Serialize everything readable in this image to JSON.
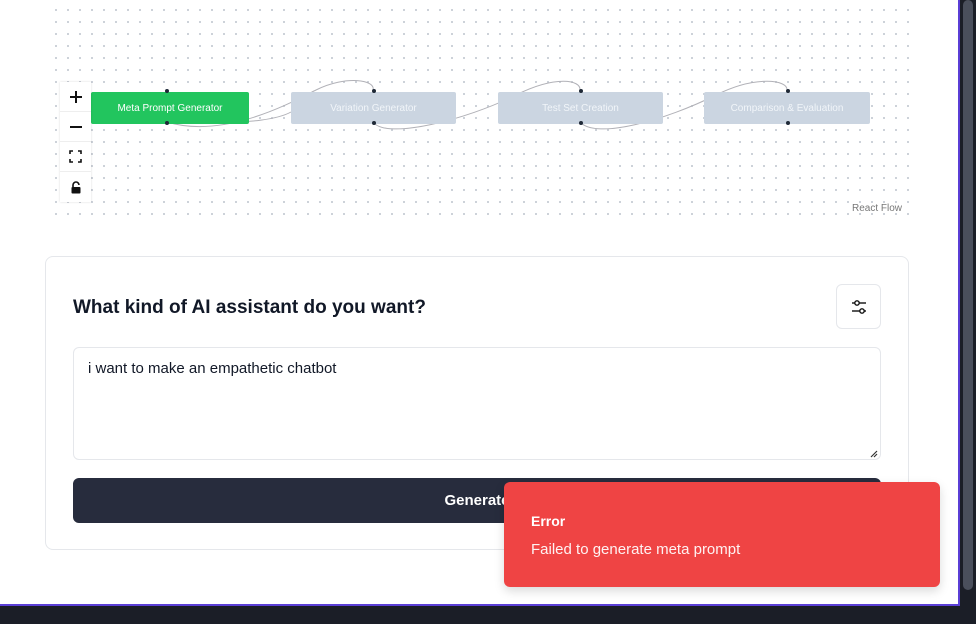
{
  "flow": {
    "nodes": [
      {
        "label": "Meta Prompt Generator",
        "state": "active"
      },
      {
        "label": "Variation Generator",
        "state": "inactive"
      },
      {
        "label": "Test Set Creation",
        "state": "inactive"
      },
      {
        "label": "Comparison & Evaluation",
        "state": "inactive"
      }
    ],
    "controls": {
      "zoom_in_icon": "plus-icon",
      "zoom_out_icon": "minus-icon",
      "fit_view_icon": "fit-view-icon",
      "lock_icon": "lock-icon"
    },
    "attribution": "React Flow",
    "active_color": "#22c55e",
    "inactive_color": "#cbd5e1"
  },
  "card": {
    "title": "What kind of AI assistant do you want?",
    "settings_icon": "sliders-icon",
    "prompt_value": "i want to make an empathetic chatbot",
    "generate_label": "Generate"
  },
  "toast": {
    "title": "Error",
    "description": "Failed to generate meta prompt",
    "color": "#ef4444"
  }
}
